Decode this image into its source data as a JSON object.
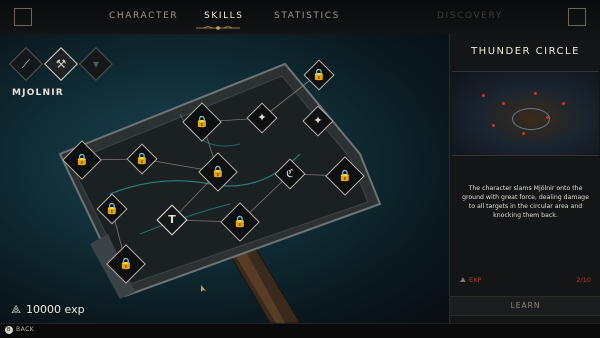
{
  "nav": {
    "tabs": [
      {
        "label": "CHARACTER",
        "state": "normal"
      },
      {
        "label": "SKILLS",
        "state": "active"
      },
      {
        "label": "STATISTICS",
        "state": "normal"
      },
      {
        "label": "DISCOVERY",
        "state": "disabled"
      }
    ],
    "left_button_icon": "square-frame-icon",
    "right_button_icon": "square-frame-icon"
  },
  "weapons": {
    "items": [
      {
        "icon": "sword-icon",
        "glyph": "⟋",
        "selected": false
      },
      {
        "icon": "hammer-icon",
        "glyph": "⚒",
        "selected": true
      },
      {
        "icon": "weapon-slot-icon",
        "glyph": "▾",
        "selected": false
      }
    ],
    "selected_name": "MJOLNIR"
  },
  "skill_tree": {
    "nodes": [
      {
        "icon": "lock-icon",
        "glyph": "🔒",
        "locked": true
      },
      {
        "icon": "lock-icon",
        "glyph": "🔒",
        "locked": true
      },
      {
        "icon": "skill-icon",
        "glyph": "✦",
        "locked": false
      },
      {
        "icon": "skill-icon",
        "glyph": "✦",
        "locked": false
      },
      {
        "icon": "lock-icon",
        "glyph": "🔒",
        "locked": true
      },
      {
        "icon": "lock-icon",
        "glyph": "🔒",
        "locked": true
      },
      {
        "icon": "lock-icon",
        "glyph": "🔒",
        "locked": true
      },
      {
        "icon": "skill-icon",
        "glyph": "ℭ",
        "locked": false
      },
      {
        "icon": "lock-icon",
        "glyph": "🔒",
        "locked": true
      },
      {
        "icon": "lock-icon",
        "glyph": "🔒",
        "locked": true
      },
      {
        "icon": "hammer-icon",
        "glyph": "T",
        "locked": false,
        "selected": true
      },
      {
        "icon": "lock-icon",
        "glyph": "🔒",
        "locked": true
      },
      {
        "icon": "lock-icon",
        "glyph": "🔒",
        "locked": true
      }
    ]
  },
  "player": {
    "exp_icon": "rune-icon",
    "exp_text": "10000 exp"
  },
  "footer": {
    "back_key": "B",
    "back_label": "BACK"
  },
  "skill_panel": {
    "title": "THUNDER CIRCLE",
    "description": "The character slams Mjölnir onto the ground with great force, dealing damage to all targets in the circular area and knocking them back.",
    "cost_label": "EXP",
    "level": "2/10",
    "learn_label": "LEARN"
  },
  "colors": {
    "accent_gold": "#c9a15a",
    "cost_red": "#c0392b",
    "panel_bg": "#131516",
    "glow_teal": "#2fd3c0"
  }
}
